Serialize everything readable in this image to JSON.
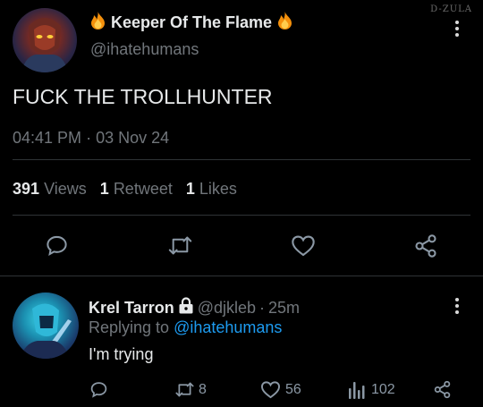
{
  "watermark": "D-ZULA",
  "tweet": {
    "display_name": "Keeper Of The Flame",
    "name_emoji": "fire-emoji",
    "handle": "@ihatehumans",
    "text": "FUCK THE TROLLHUNTER",
    "time": "04:41 PM",
    "separator": "·",
    "date": "03 Nov 24",
    "stats": {
      "views_count": "391",
      "views_label": "Views",
      "retweets_count": "1",
      "retweets_label": "Retweet",
      "likes_count": "1",
      "likes_label": "Likes"
    },
    "actions": [
      "reply-icon",
      "retweet-icon",
      "like-icon",
      "share-icon"
    ]
  },
  "reply": {
    "display_name": "Krel Tarron",
    "badge": "lock-icon",
    "handle": "@djkleb",
    "separator": "·",
    "age": "25m",
    "replying_prefix": "Replying to",
    "replying_to": "@ihatehumans",
    "text": "I'm trying",
    "actions": {
      "retweets": "8",
      "likes": "56",
      "views": "102"
    }
  },
  "colors": {
    "background": "#000000",
    "text": "#e7e9ea",
    "muted": "#71767b",
    "accent": "#1d9bf0",
    "divider": "#2f3336"
  }
}
